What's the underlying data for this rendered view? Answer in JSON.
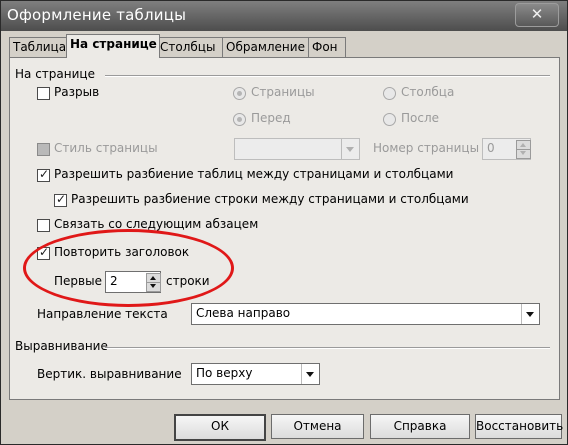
{
  "window": {
    "title": "Оформление таблицы",
    "close_label": "✕"
  },
  "tabs": [
    {
      "label": "Таблица",
      "active": false
    },
    {
      "label": "На странице",
      "active": true
    },
    {
      "label": "Столбцы",
      "active": false
    },
    {
      "label": "Обрамление",
      "active": false
    },
    {
      "label": "Фон",
      "active": false
    }
  ],
  "page_group": {
    "title": "На странице",
    "break_label": "Разрыв",
    "break_checked": false,
    "radio_page": "Страницы",
    "radio_column": "Столбца",
    "radio_before": "Перед",
    "radio_after": "После",
    "page_style_label": "Стиль страницы",
    "page_style_value": "",
    "page_number_label": "Номер страницы",
    "page_number_value": "0",
    "allow_split_tables_label": "Разрешить разбиение таблиц между страницами и столбцами",
    "allow_split_tables_checked": true,
    "allow_split_rows_label": "Разрешить разбиение строки между страницами и столбцами",
    "allow_split_rows_checked": true,
    "keep_with_next_label": "Связать со следующим абзацем",
    "keep_with_next_checked": false,
    "repeat_heading_label": "Повторить заголовок",
    "repeat_heading_checked": true,
    "first_label": "Первые",
    "first_value": "2",
    "rows_label": "строки",
    "text_direction_label": "Направление текста",
    "text_direction_value": "Слева направо"
  },
  "alignment_group": {
    "title": "Выравнивание",
    "vertical_label": "Вертик. выравнивание",
    "vertical_value": "По верху"
  },
  "buttons": {
    "ok": "ОК",
    "cancel": "Отмена",
    "help": "Справка",
    "reset": "Восстановить"
  },
  "colors": {
    "highlight_oval": "#e01818",
    "dialog_bg": "#eceae6"
  },
  "icons": {
    "check": "✓",
    "close": "close-icon",
    "dropdown": "chevron-down-icon"
  }
}
